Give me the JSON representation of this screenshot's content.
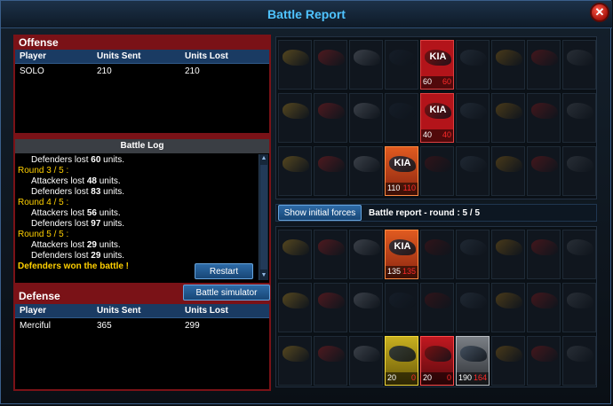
{
  "window": {
    "title": "Battle Report"
  },
  "offense": {
    "title": "Offense",
    "columns": [
      "Player",
      "Units Sent",
      "Units Lost"
    ],
    "rows": [
      {
        "player": "SOLO",
        "sent": "210",
        "lost": "210"
      }
    ]
  },
  "battle_log": {
    "title": "Battle Log",
    "lines": [
      {
        "type": "line",
        "text": "Defenders lost",
        "num": "60",
        "suffix": "units."
      },
      {
        "type": "round",
        "text": "Round 3 / 5 :"
      },
      {
        "type": "line",
        "text": "Attackers lost",
        "num": "48",
        "suffix": "units."
      },
      {
        "type": "line",
        "text": "Defenders lost",
        "num": "83",
        "suffix": "units."
      },
      {
        "type": "round",
        "text": "Round 4 / 5 :"
      },
      {
        "type": "line",
        "text": "Attackers lost",
        "num": "56",
        "suffix": "units."
      },
      {
        "type": "line",
        "text": "Defenders lost",
        "num": "97",
        "suffix": "units."
      },
      {
        "type": "round",
        "text": "Round 5 / 5 :"
      },
      {
        "type": "line",
        "text": "Attackers lost",
        "num": "29",
        "suffix": "units."
      },
      {
        "type": "line",
        "text": "Defenders lost",
        "num": "29",
        "suffix": "units."
      },
      {
        "type": "won",
        "text": "Defenders won the battle !"
      }
    ],
    "restart_label": "Restart"
  },
  "simulator_label": "Battle simulator",
  "defense": {
    "title": "Defense",
    "columns": [
      "Player",
      "Units Sent",
      "Units Lost"
    ],
    "rows": [
      {
        "player": "Merciful",
        "sent": "365",
        "lost": "299"
      }
    ]
  },
  "controls": {
    "show_initial_label": "Show initial forces",
    "round_info": "Battle report - round : 5 / 5"
  },
  "kia_label": "KIA",
  "top_units": [
    {
      "row": 0,
      "col": 4,
      "style": "active",
      "kia": true,
      "count": "60",
      "lost": "60"
    },
    {
      "row": 1,
      "col": 4,
      "style": "active",
      "kia": true,
      "count": "40",
      "lost": "40"
    },
    {
      "row": 2,
      "col": 3,
      "style": "active-orange",
      "kia": true,
      "count": "110",
      "lost": "110"
    }
  ],
  "bottom_units": [
    {
      "row": 0,
      "col": 3,
      "style": "active-orange",
      "kia": true,
      "count": "135",
      "lost": "135"
    },
    {
      "row": 2,
      "col": 3,
      "style": "active-yellow",
      "kia": false,
      "count": "20",
      "lost": "0"
    },
    {
      "row": 2,
      "col": 4,
      "style": "active-red",
      "kia": false,
      "count": "20",
      "lost": "0"
    },
    {
      "row": 2,
      "col": 5,
      "style": "active-grey",
      "kia": false,
      "count": "190",
      "lost": "164"
    }
  ],
  "ship_colors": [
    "#d4a020",
    "#c02020",
    "#8a8f98",
    "#1e2a3a",
    "#6a1010",
    "#3c4a5a",
    "#b07a10",
    "#a01818",
    "#555b63"
  ]
}
